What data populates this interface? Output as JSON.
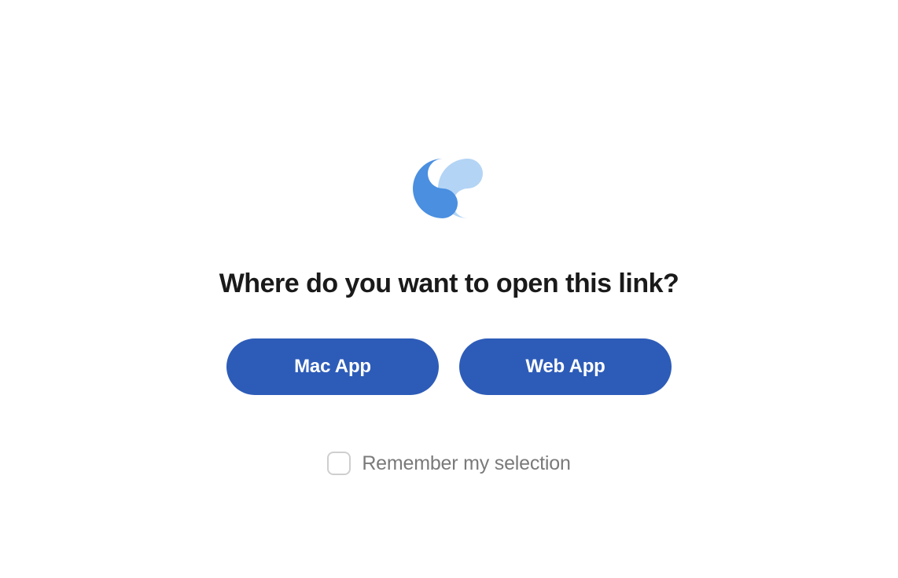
{
  "heading": "Where do you want to open this link?",
  "buttons": {
    "mac": "Mac App",
    "web": "Web App"
  },
  "remember": {
    "label": "Remember my selection",
    "checked": false
  },
  "colors": {
    "button_bg": "#2d5cb8",
    "logo_dark": "#4a8fe0",
    "logo_light": "#b3d4f5"
  }
}
